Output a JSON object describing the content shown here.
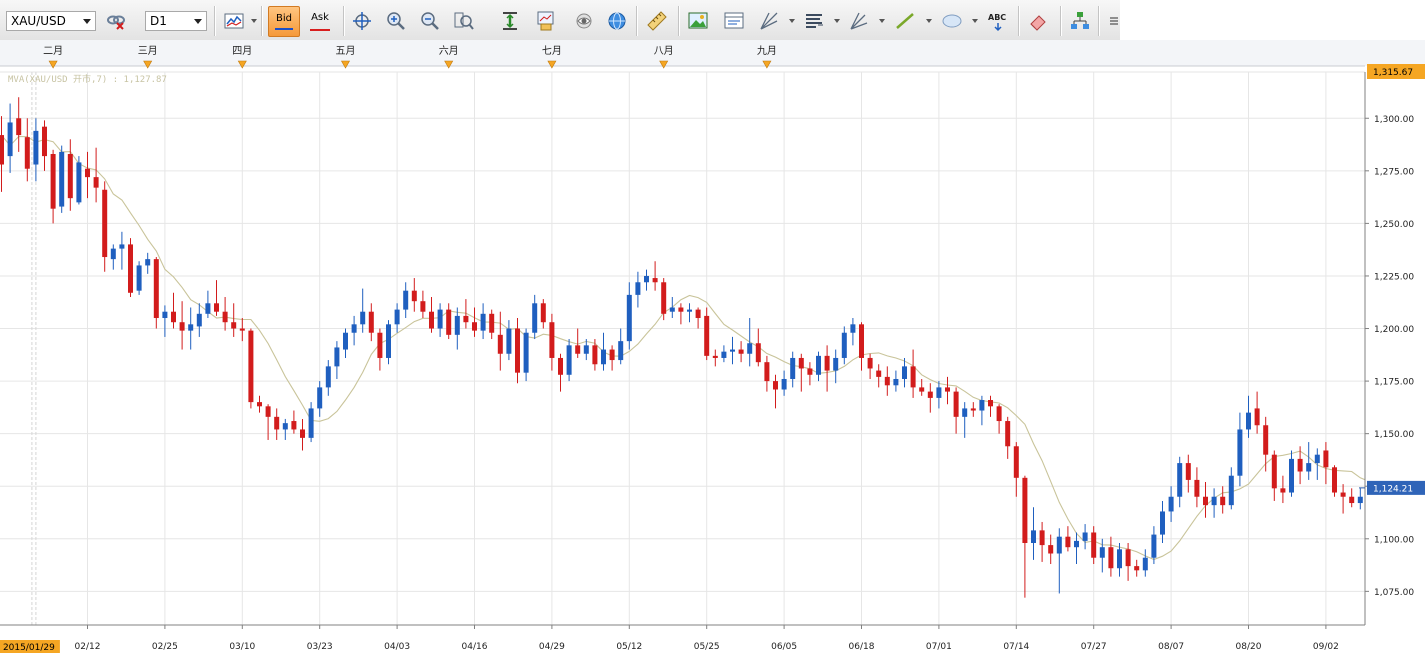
{
  "toolbar": {
    "symbol": "XAU/USD",
    "timeframe": "D1",
    "bid_label": "Bid",
    "ask_label": "Ask",
    "text_tool_label": "ABC",
    "icons": [
      "link-icon",
      "chart-type-icon",
      "crosshair-icon",
      "zoom-in-icon",
      "zoom-out-icon",
      "cursor-icon",
      "zoom-fit-icon",
      "period-separator-icon",
      "export-chart-icon",
      "eye-icon",
      "globe-icon",
      "ruler-icon",
      "image-icon",
      "template-icon",
      "fibonacci-icon",
      "indicator-list-icon",
      "pitchfork-icon",
      "trendline-icon",
      "ellipse-icon",
      "text-icon",
      "eraser-icon",
      "hierarchy-icon",
      "settings-icon"
    ]
  },
  "colors": {
    "up": "#1f5fbf",
    "down": "#d21c1c",
    "ma": "#c9c49a",
    "grid": "#e6e6e6",
    "marker": "#f5a623",
    "price_badge": "#f5a623"
  },
  "chart_data": {
    "type": "candlestick",
    "symbol": "XAU/USD",
    "timeframe": "D1",
    "indicator_label": "MVA(XAU/USD 开市,7) : 1,127.87",
    "indicator": {
      "name": "MVA",
      "source": "开市",
      "period": 7,
      "last_value": 1127.87
    },
    "y_axis": {
      "min": 1059,
      "max": 1322,
      "ticks": [
        1075,
        1100,
        1125,
        1150,
        1175,
        1200,
        1225,
        1250,
        1275,
        1300
      ],
      "tick_labels": [
        "1,075.00",
        "1,100.00",
        "1,125.00",
        "1,150.00",
        "1,175.00",
        "1,200.00",
        "1,225.00",
        "1,250.00",
        "1,275.00",
        "1,300.00"
      ],
      "top_label": "1,315.67",
      "current_price": 1124.21,
      "current_price_label": "1,124.21"
    },
    "x_axis": {
      "date_labels": [
        "02/12",
        "02/25",
        "03/10",
        "03/23",
        "04/03",
        "04/16",
        "04/29",
        "05/12",
        "05/25",
        "06/05",
        "06/18",
        "07/01",
        "07/14",
        "07/27",
        "08/07",
        "08/20",
        "09/02"
      ],
      "date_label_index": [
        10,
        19,
        28,
        37,
        46,
        55,
        64,
        73,
        82,
        91,
        100,
        109,
        118,
        127,
        136,
        145,
        154
      ],
      "cursor_label": "2015/01/29",
      "cursor_index": 4,
      "left_partial_label": "2015",
      "month_labels": [
        "二月",
        "三月",
        "四月",
        "五月",
        "六月",
        "七月",
        "八月",
        "九月"
      ],
      "month_index": [
        6,
        17,
        28,
        40,
        52,
        64,
        77,
        89
      ]
    },
    "candles": [
      [
        1292,
        1301,
        1265,
        1278
      ],
      [
        1282,
        1307,
        1274,
        1298
      ],
      [
        1300,
        1310,
        1284,
        1292
      ],
      [
        1291,
        1300,
        1270,
        1276
      ],
      [
        1278,
        1300,
        1270,
        1294
      ],
      [
        1296,
        1299,
        1275,
        1282
      ],
      [
        1283,
        1285,
        1250,
        1257
      ],
      [
        1258,
        1287,
        1255,
        1284
      ],
      [
        1283,
        1290,
        1256,
        1262
      ],
      [
        1260,
        1282,
        1259,
        1279
      ],
      [
        1276,
        1284,
        1262,
        1272
      ],
      [
        1272,
        1286,
        1260,
        1267
      ],
      [
        1266,
        1270,
        1227,
        1234
      ],
      [
        1233,
        1240,
        1228,
        1238
      ],
      [
        1238,
        1246,
        1228,
        1240
      ],
      [
        1240,
        1243,
        1215,
        1217
      ],
      [
        1218,
        1232,
        1216,
        1230
      ],
      [
        1230,
        1236,
        1226,
        1233
      ],
      [
        1233,
        1234,
        1200,
        1205
      ],
      [
        1205,
        1211,
        1196,
        1208
      ],
      [
        1208,
        1217,
        1200,
        1203
      ],
      [
        1203,
        1213,
        1190,
        1199
      ],
      [
        1199,
        1210,
        1190,
        1202
      ],
      [
        1201,
        1212,
        1196,
        1207
      ],
      [
        1207,
        1218,
        1205,
        1212
      ],
      [
        1212,
        1223,
        1206,
        1208
      ],
      [
        1208,
        1215,
        1199,
        1203
      ],
      [
        1203,
        1212,
        1196,
        1200
      ],
      [
        1200,
        1205,
        1194,
        1199
      ],
      [
        1199,
        1200,
        1162,
        1165
      ],
      [
        1165,
        1168,
        1160,
        1163
      ],
      [
        1163,
        1164,
        1147,
        1158
      ],
      [
        1158,
        1162,
        1147,
        1152
      ],
      [
        1152,
        1157,
        1147,
        1155
      ],
      [
        1156,
        1161,
        1150,
        1152
      ],
      [
        1152,
        1157,
        1142,
        1148
      ],
      [
        1148,
        1165,
        1146,
        1162
      ],
      [
        1162,
        1175,
        1158,
        1172
      ],
      [
        1172,
        1185,
        1168,
        1182
      ],
      [
        1182,
        1194,
        1176,
        1191
      ],
      [
        1190,
        1200,
        1186,
        1198
      ],
      [
        1198,
        1206,
        1192,
        1202
      ],
      [
        1202,
        1219,
        1198,
        1208
      ],
      [
        1208,
        1212,
        1194,
        1198
      ],
      [
        1198,
        1200,
        1180,
        1186
      ],
      [
        1186,
        1204,
        1183,
        1202
      ],
      [
        1202,
        1212,
        1198,
        1209
      ],
      [
        1209,
        1222,
        1205,
        1218
      ],
      [
        1218,
        1224,
        1208,
        1213
      ],
      [
        1213,
        1218,
        1205,
        1208
      ],
      [
        1208,
        1215,
        1198,
        1200
      ],
      [
        1200,
        1212,
        1196,
        1209
      ],
      [
        1209,
        1212,
        1195,
        1197
      ],
      [
        1197,
        1210,
        1190,
        1206
      ],
      [
        1206,
        1214,
        1200,
        1203
      ],
      [
        1203,
        1210,
        1196,
        1199
      ],
      [
        1199,
        1212,
        1195,
        1207
      ],
      [
        1207,
        1209,
        1195,
        1198
      ],
      [
        1197,
        1208,
        1180,
        1188
      ],
      [
        1188,
        1204,
        1185,
        1200
      ],
      [
        1200,
        1205,
        1174,
        1179
      ],
      [
        1179,
        1200,
        1175,
        1198
      ],
      [
        1198,
        1216,
        1195,
        1212
      ],
      [
        1212,
        1214,
        1200,
        1203
      ],
      [
        1203,
        1207,
        1180,
        1186
      ],
      [
        1186,
        1188,
        1170,
        1178
      ],
      [
        1178,
        1195,
        1175,
        1192
      ],
      [
        1192,
        1200,
        1186,
        1188
      ],
      [
        1188,
        1195,
        1185,
        1192
      ],
      [
        1192,
        1195,
        1180,
        1183
      ],
      [
        1183,
        1198,
        1180,
        1190
      ],
      [
        1190,
        1192,
        1180,
        1185
      ],
      [
        1185,
        1200,
        1183,
        1194
      ],
      [
        1194,
        1222,
        1190,
        1216
      ],
      [
        1216,
        1227,
        1210,
        1222
      ],
      [
        1222,
        1228,
        1218,
        1225
      ],
      [
        1224,
        1232,
        1218,
        1222
      ],
      [
        1222,
        1224,
        1204,
        1207
      ],
      [
        1208,
        1215,
        1205,
        1210
      ],
      [
        1210,
        1212,
        1202,
        1208
      ],
      [
        1208,
        1212,
        1203,
        1209
      ],
      [
        1209,
        1210,
        1200,
        1205
      ],
      [
        1206,
        1210,
        1185,
        1187
      ],
      [
        1187,
        1190,
        1182,
        1186
      ],
      [
        1186,
        1192,
        1184,
        1189
      ],
      [
        1189,
        1196,
        1183,
        1190
      ],
      [
        1190,
        1194,
        1184,
        1188
      ],
      [
        1188,
        1205,
        1182,
        1193
      ],
      [
        1193,
        1200,
        1182,
        1184
      ],
      [
        1184,
        1187,
        1170,
        1175
      ],
      [
        1175,
        1178,
        1162,
        1171
      ],
      [
        1171,
        1180,
        1168,
        1176
      ],
      [
        1176,
        1189,
        1172,
        1186
      ],
      [
        1186,
        1188,
        1170,
        1181
      ],
      [
        1181,
        1184,
        1173,
        1178
      ],
      [
        1178,
        1189,
        1175,
        1187
      ],
      [
        1187,
        1192,
        1170,
        1180
      ],
      [
        1180,
        1190,
        1174,
        1186
      ],
      [
        1186,
        1201,
        1183,
        1198
      ],
      [
        1198,
        1205,
        1192,
        1202
      ],
      [
        1202,
        1203,
        1180,
        1186
      ],
      [
        1186,
        1188,
        1176,
        1181
      ],
      [
        1180,
        1183,
        1172,
        1177
      ],
      [
        1177,
        1182,
        1168,
        1173
      ],
      [
        1173,
        1180,
        1170,
        1176
      ],
      [
        1176,
        1186,
        1172,
        1182
      ],
      [
        1182,
        1190,
        1167,
        1172
      ],
      [
        1172,
        1176,
        1168,
        1170
      ],
      [
        1170,
        1174,
        1160,
        1167
      ],
      [
        1167,
        1175,
        1162,
        1172
      ],
      [
        1172,
        1177,
        1164,
        1170
      ],
      [
        1170,
        1172,
        1150,
        1158
      ],
      [
        1158,
        1165,
        1148,
        1162
      ],
      [
        1162,
        1165,
        1158,
        1161
      ],
      [
        1161,
        1168,
        1154,
        1166
      ],
      [
        1166,
        1168,
        1158,
        1163
      ],
      [
        1163,
        1164,
        1150,
        1156
      ],
      [
        1156,
        1158,
        1138,
        1144
      ],
      [
        1144,
        1146,
        1120,
        1129
      ],
      [
        1129,
        1130,
        1072,
        1098
      ],
      [
        1098,
        1115,
        1090,
        1104
      ],
      [
        1104,
        1108,
        1089,
        1097
      ],
      [
        1097,
        1102,
        1088,
        1093
      ],
      [
        1093,
        1105,
        1074,
        1101
      ],
      [
        1101,
        1106,
        1094,
        1096
      ],
      [
        1096,
        1103,
        1088,
        1099
      ],
      [
        1099,
        1107,
        1095,
        1103
      ],
      [
        1103,
        1106,
        1088,
        1091
      ],
      [
        1091,
        1100,
        1084,
        1096
      ],
      [
        1096,
        1101,
        1082,
        1086
      ],
      [
        1086,
        1098,
        1082,
        1095
      ],
      [
        1095,
        1098,
        1080,
        1087
      ],
      [
        1087,
        1090,
        1082,
        1085
      ],
      [
        1085,
        1095,
        1082,
        1091
      ],
      [
        1091,
        1106,
        1088,
        1102
      ],
      [
        1102,
        1118,
        1098,
        1113
      ],
      [
        1113,
        1125,
        1108,
        1120
      ],
      [
        1120,
        1139,
        1115,
        1136
      ],
      [
        1136,
        1140,
        1122,
        1128
      ],
      [
        1128,
        1134,
        1115,
        1120
      ],
      [
        1120,
        1127,
        1110,
        1116
      ],
      [
        1116,
        1124,
        1110,
        1120
      ],
      [
        1120,
        1125,
        1112,
        1116
      ],
      [
        1116,
        1134,
        1114,
        1130
      ],
      [
        1130,
        1160,
        1125,
        1152
      ],
      [
        1152,
        1168,
        1148,
        1160
      ],
      [
        1162,
        1170,
        1150,
        1154
      ],
      [
        1154,
        1158,
        1132,
        1140
      ],
      [
        1140,
        1142,
        1118,
        1124
      ],
      [
        1124,
        1130,
        1117,
        1122
      ],
      [
        1122,
        1142,
        1120,
        1138
      ],
      [
        1138,
        1144,
        1126,
        1132
      ],
      [
        1132,
        1146,
        1128,
        1136
      ],
      [
        1136,
        1143,
        1128,
        1140
      ],
      [
        1142,
        1146,
        1126,
        1134
      ],
      [
        1134,
        1135,
        1120,
        1122
      ],
      [
        1122,
        1126,
        1112,
        1120
      ],
      [
        1120,
        1124,
        1115,
        1117
      ],
      [
        1117,
        1124,
        1114,
        1120
      ],
      [
        1120,
        1126,
        1116,
        1124
      ]
    ]
  }
}
